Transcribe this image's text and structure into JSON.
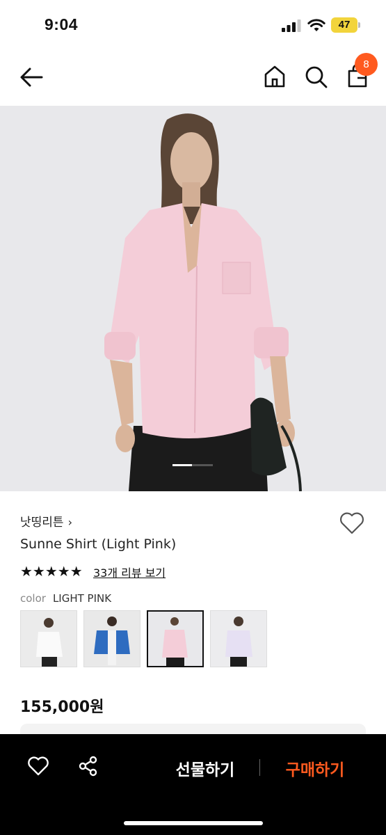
{
  "status_bar": {
    "time": "9:04",
    "battery": "47"
  },
  "nav": {
    "cart_count": "8"
  },
  "product": {
    "brand": "낫띵리튼",
    "brand_chevron": "›",
    "name": "Sunne Shirt (Light Pink)",
    "rating_stars": "★★★★★",
    "rating_value": 5,
    "review_link": "33개 리뷰 보기",
    "color_label": "color",
    "color_value": "LIGHT PINK",
    "variants": [
      "white",
      "blue",
      "light-pink",
      "lavender"
    ],
    "selected_variant": "light-pink",
    "price": "155,000원"
  },
  "bottom_bar": {
    "gift_label": "선물하기",
    "buy_label": "구매하기"
  },
  "colors": {
    "accent": "#ff5a1f",
    "bottom_bar_bg": "#000000",
    "battery": "#f2d43c"
  },
  "icons": [
    "back-arrow-icon",
    "home-icon",
    "search-icon",
    "cart-icon",
    "heart-icon",
    "share-icon",
    "signal-icon",
    "wifi-icon",
    "battery-icon",
    "star-icon"
  ]
}
